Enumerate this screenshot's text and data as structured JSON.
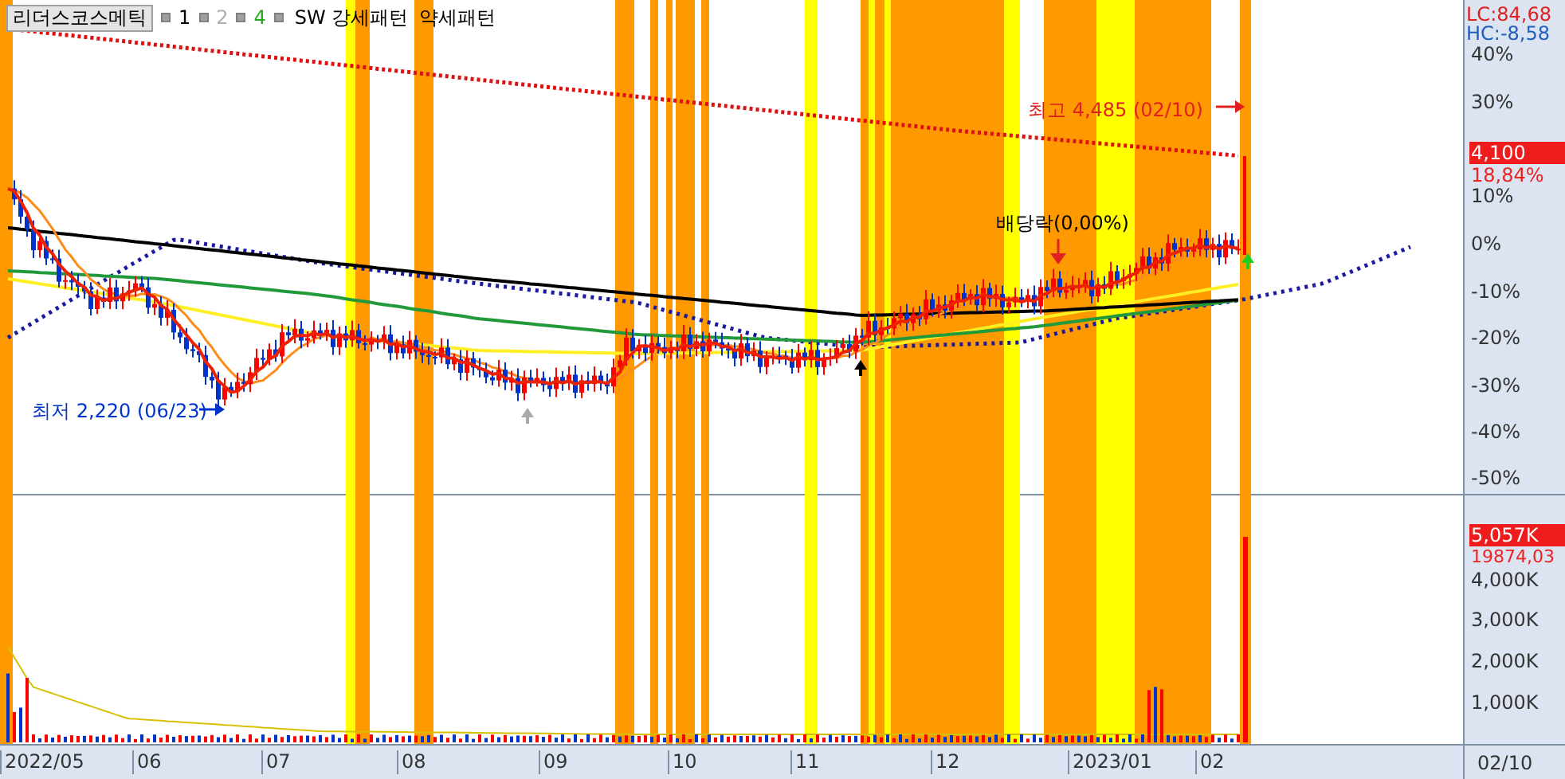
{
  "legend": {
    "title": "리더스코스메틱",
    "items": [
      {
        "label": "1",
        "color": "#000000"
      },
      {
        "label": "2",
        "color": "#b0b0b0"
      },
      {
        "label": "4",
        "color": "#22aa22"
      }
    ],
    "patterns": [
      "SW 강세패턴",
      "약세패턴"
    ]
  },
  "annotations": [
    {
      "kind": "high",
      "text": "최고 4,485 (02/10)"
    },
    {
      "kind": "dividend",
      "text": "배당락(0,00%)"
    },
    {
      "kind": "low",
      "text": "최저 2,220 (06/23)"
    }
  ],
  "price_axis": {
    "lc": "LC:84,68",
    "hc": "HC:-8,58",
    "current_price": "4,100",
    "change": "18,84%",
    "ticks": [
      "40%",
      "30%",
      "10%",
      "0%",
      "-10%",
      "-20%",
      "-30%",
      "-40%",
      "-50%"
    ]
  },
  "volume_axis": {
    "current_volume": "5,057K",
    "change": "19874,03",
    "ticks": [
      "4,000K",
      "3,000K",
      "2,000K",
      "1,000K"
    ]
  },
  "x_axis": {
    "labels": [
      "2022/05",
      "06",
      "07",
      "08",
      "09",
      "10",
      "11",
      "12",
      "2023/01",
      "02"
    ],
    "cursor_date": "02/10"
  }
}
